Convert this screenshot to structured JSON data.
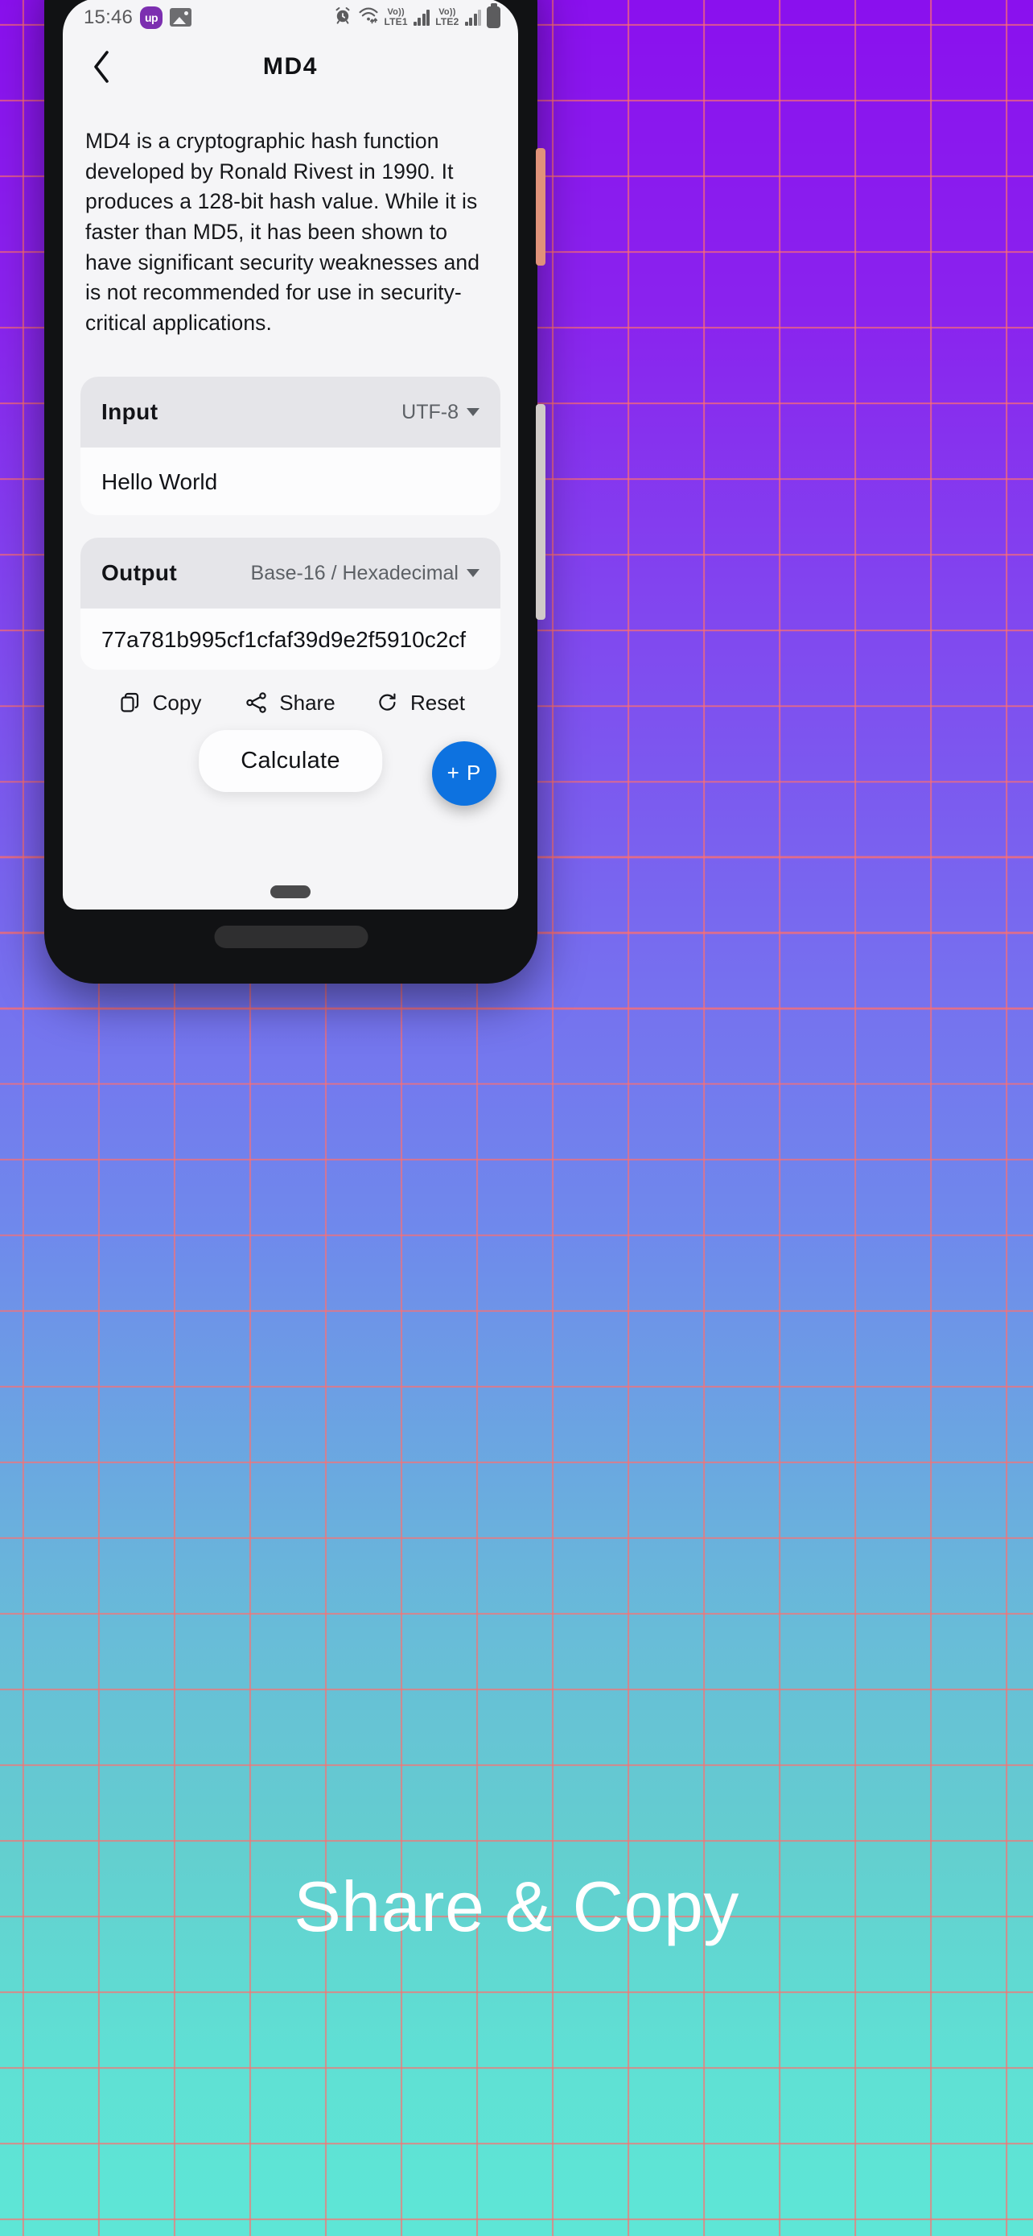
{
  "background": {
    "gradient_top": "#8a10ee",
    "gradient_bottom": "#5ee6d6",
    "grid_color": "#ff6e6e",
    "grid_spacing_px": 94
  },
  "caption": "Share & Copy",
  "device": {
    "frame_color": "#111214",
    "power_button_color": "#e0927a",
    "volume_button_color": "#d0cbc8"
  },
  "status_bar": {
    "time": "15:46",
    "left_icons": [
      "up-badge-icon",
      "image-icon"
    ],
    "right_icons": [
      "alarm-icon",
      "wifi-icon",
      "signal-lte1-icon",
      "signal-lte2-icon",
      "battery-icon"
    ],
    "sim1_label_top": "Vo))",
    "sim1_label_bottom": "LTE1",
    "sim2_label_top": "Vo))",
    "sim2_label_bottom": "LTE2",
    "badge_text": "up"
  },
  "app_bar": {
    "back_icon": "chevron-left-icon",
    "title": "MD4"
  },
  "description": "MD4 is a cryptographic hash function developed by Ronald Rivest in 1990. It produces a 128-bit hash value. While it is faster than MD5, it has been shown to have significant security weaknesses and is not recommended for use in security-critical applications.",
  "input_card": {
    "label": "Input",
    "encoding": "UTF-8",
    "caret_icon": "chevron-down-icon",
    "value": "Hello World"
  },
  "output_card": {
    "label": "Output",
    "encoding": "Base-16 / Hexadecimal",
    "caret_icon": "chevron-down-icon",
    "value": "77a781b995cf1cfaf39d9e2f5910c2cf"
  },
  "actions": [
    {
      "label": "Copy",
      "icon": "copy-icon"
    },
    {
      "label": "Share",
      "icon": "share-icon"
    },
    {
      "label": "Reset",
      "icon": "reset-icon"
    }
  ],
  "footer": {
    "calculate_label": "Calculate",
    "fab_label": "+ P",
    "fab_color": "#0d72e0"
  }
}
